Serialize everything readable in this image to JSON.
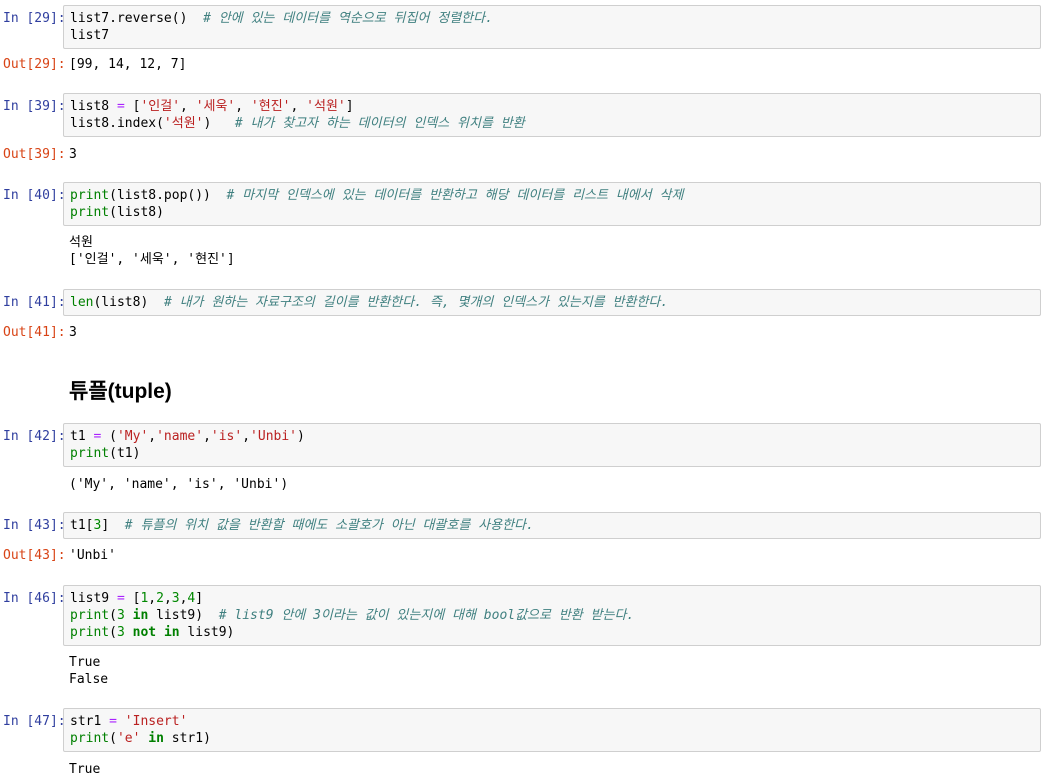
{
  "cells": [
    {
      "prompt": "In [29]:",
      "lines": [
        [
          [
            "n",
            "list7.reverse()  "
          ],
          [
            "cm",
            "# 안에 있는 데이터를 역순으로 뒤집어 정렬한다."
          ]
        ],
        [
          [
            "n",
            "list7"
          ]
        ]
      ],
      "out_prompt": "Out[29]:",
      "output": [
        "[99, 14, 12, 7]"
      ]
    },
    {
      "prompt": "In [39]:",
      "lines": [
        [
          [
            "n",
            "list8 "
          ],
          [
            "op",
            "="
          ],
          [
            "n",
            " ["
          ],
          [
            "st",
            "'인걸'"
          ],
          [
            "n",
            ", "
          ],
          [
            "st",
            "'세욱'"
          ],
          [
            "n",
            ", "
          ],
          [
            "st",
            "'현진'"
          ],
          [
            "n",
            ", "
          ],
          [
            "st",
            "'석원'"
          ],
          [
            "n",
            "]"
          ]
        ],
        [
          [
            "n",
            "list8.index("
          ],
          [
            "st",
            "'석원'"
          ],
          [
            "n",
            ")   "
          ],
          [
            "cm",
            "# 내가 찾고자 하는 데이터의 인덱스 위치를 반환"
          ]
        ]
      ],
      "out_prompt": "Out[39]:",
      "output": [
        "3"
      ]
    },
    {
      "prompt": "In [40]:",
      "lines": [
        [
          [
            "kw",
            "print"
          ],
          [
            "n",
            "(list8.pop())  "
          ],
          [
            "cm",
            "# 마지막 인덱스에 있는 데이터를 반환하고 해당 데이터를 리스트 내에서 삭제"
          ]
        ],
        [
          [
            "kw",
            "print"
          ],
          [
            "n",
            "(list8)"
          ]
        ]
      ],
      "out_prompt": "",
      "output": [
        "석원",
        "['인걸', '세욱', '현진']"
      ]
    },
    {
      "prompt": "In [41]:",
      "lines": [
        [
          [
            "kw",
            "len"
          ],
          [
            "n",
            "(list8)  "
          ],
          [
            "cm",
            "# 내가 원하는 자료구조의 길이를 반환한다. 즉, 몇개의 인덱스가 있는지를 반환한다."
          ]
        ]
      ],
      "out_prompt": "Out[41]:",
      "output": [
        "3"
      ]
    },
    {
      "prompt": "In [42]:",
      "lines": [
        [
          [
            "n",
            "t1 "
          ],
          [
            "op",
            "="
          ],
          [
            "n",
            " ("
          ],
          [
            "st",
            "'My'"
          ],
          [
            "n",
            ","
          ],
          [
            "st",
            "'name'"
          ],
          [
            "n",
            ","
          ],
          [
            "st",
            "'is'"
          ],
          [
            "n",
            ","
          ],
          [
            "st",
            "'Unbi'"
          ],
          [
            "n",
            ")"
          ]
        ],
        [
          [
            "kw",
            "print"
          ],
          [
            "n",
            "(t1)"
          ]
        ]
      ],
      "out_prompt": "",
      "output": [
        "('My', 'name', 'is', 'Unbi')"
      ]
    },
    {
      "prompt": "In [43]:",
      "lines": [
        [
          [
            "n",
            "t1["
          ],
          [
            "nm",
            "3"
          ],
          [
            "n",
            "]  "
          ],
          [
            "cm",
            "# 튜플의 위치 값을 반환할 때에도 소괄호가 아닌 대괄호를 사용한다."
          ]
        ]
      ],
      "out_prompt": "Out[43]:",
      "output": [
        "'Unbi'"
      ]
    },
    {
      "prompt": "In [46]:",
      "lines": [
        [
          [
            "n",
            "list9 "
          ],
          [
            "op",
            "="
          ],
          [
            "n",
            " ["
          ],
          [
            "nm",
            "1"
          ],
          [
            "n",
            ","
          ],
          [
            "nm",
            "2"
          ],
          [
            "n",
            ","
          ],
          [
            "nm",
            "3"
          ],
          [
            "n",
            ","
          ],
          [
            "nm",
            "4"
          ],
          [
            "n",
            "]"
          ]
        ],
        [
          [
            "kw",
            "print"
          ],
          [
            "n",
            "("
          ],
          [
            "nm",
            "3"
          ],
          [
            "n",
            " "
          ],
          [
            "kwb",
            "in"
          ],
          [
            "n",
            " list9)  "
          ],
          [
            "cm",
            "# list9 안에 3이라는 값이 있는지에 대해 bool값으로 반환 받는다."
          ]
        ],
        [
          [
            "kw",
            "print"
          ],
          [
            "n",
            "("
          ],
          [
            "nm",
            "3"
          ],
          [
            "n",
            " "
          ],
          [
            "kwb",
            "not"
          ],
          [
            "n",
            " "
          ],
          [
            "kwb",
            "in"
          ],
          [
            "n",
            " list9)"
          ]
        ]
      ],
      "out_prompt": "",
      "output": [
        "True",
        "False"
      ]
    },
    {
      "prompt": "In [47]:",
      "lines": [
        [
          [
            "n",
            "str1 "
          ],
          [
            "op",
            "="
          ],
          [
            "n",
            " "
          ],
          [
            "st",
            "'Insert'"
          ]
        ],
        [
          [
            "kw",
            "print"
          ],
          [
            "n",
            "("
          ],
          [
            "st",
            "'e'"
          ],
          [
            "n",
            " "
          ],
          [
            "kwb",
            "in"
          ],
          [
            "n",
            " str1)"
          ]
        ]
      ],
      "out_prompt": "",
      "output": [
        "True"
      ]
    }
  ],
  "heading": "튜플(tuple)"
}
